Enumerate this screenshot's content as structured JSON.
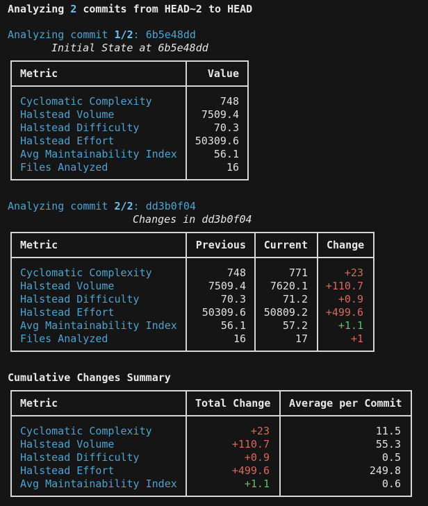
{
  "header": {
    "prefix": "Analyzing",
    "count": "2",
    "middle": "commits from HEAD~2 to HEAD"
  },
  "commit1": {
    "label": "Analyzing commit",
    "index": "1/2",
    "sep": ":",
    "hash": "6b5e48dd",
    "subtitle": "Initial State at 6b5e48dd",
    "table": {
      "headers": [
        "Metric",
        "Value"
      ],
      "rows": [
        {
          "metric": "Cyclomatic Complexity",
          "value": "748"
        },
        {
          "metric": "Halstead Volume",
          "value": "7509.4"
        },
        {
          "metric": "Halstead Difficulty",
          "value": "70.3"
        },
        {
          "metric": "Halstead Effort",
          "value": "50309.6"
        },
        {
          "metric": "Avg Maintainability Index",
          "value": "56.1"
        },
        {
          "metric": "Files Analyzed",
          "value": "16"
        }
      ]
    }
  },
  "commit2": {
    "label": "Analyzing commit",
    "index": "2/2",
    "sep": ":",
    "hash": "dd3b0f04",
    "subtitle": "Changes in dd3b0f04",
    "table": {
      "headers": [
        "Metric",
        "Previous",
        "Current",
        "Change"
      ],
      "rows": [
        {
          "metric": "Cyclomatic Complexity",
          "previous": "748",
          "current": "771",
          "change": "+23",
          "change_color": "red"
        },
        {
          "metric": "Halstead Volume",
          "previous": "7509.4",
          "current": "7620.1",
          "change": "+110.7",
          "change_color": "red"
        },
        {
          "metric": "Halstead Difficulty",
          "previous": "70.3",
          "current": "71.2",
          "change": "+0.9",
          "change_color": "red"
        },
        {
          "metric": "Halstead Effort",
          "previous": "50309.6",
          "current": "50809.2",
          "change": "+499.6",
          "change_color": "red"
        },
        {
          "metric": "Avg Maintainability Index",
          "previous": "56.1",
          "current": "57.2",
          "change": "+1.1",
          "change_color": "green"
        },
        {
          "metric": "Files Analyzed",
          "previous": "16",
          "current": "17",
          "change": "+1",
          "change_color": "red"
        }
      ]
    }
  },
  "summary": {
    "title": "Cumulative Changes Summary",
    "table": {
      "headers": [
        "Metric",
        "Total Change",
        "Average per Commit"
      ],
      "rows": [
        {
          "metric": "Cyclomatic Complexity",
          "total": "+23",
          "total_color": "red",
          "avg": "11.5"
        },
        {
          "metric": "Halstead Volume",
          "total": "+110.7",
          "total_color": "red",
          "avg": "55.3"
        },
        {
          "metric": "Halstead Difficulty",
          "total": "+0.9",
          "total_color": "red",
          "avg": "0.5"
        },
        {
          "metric": "Halstead Effort",
          "total": "+499.6",
          "total_color": "red",
          "avg": "249.8"
        },
        {
          "metric": "Avg Maintainability Index",
          "total": "+1.1",
          "total_color": "green",
          "avg": "0.6"
        }
      ]
    }
  },
  "colors": {
    "background": "#151515",
    "metric_blue": "#4fa3d1",
    "increase_red": "#d9675c",
    "improve_green": "#5fc06a",
    "border": "#d8d8d8"
  }
}
